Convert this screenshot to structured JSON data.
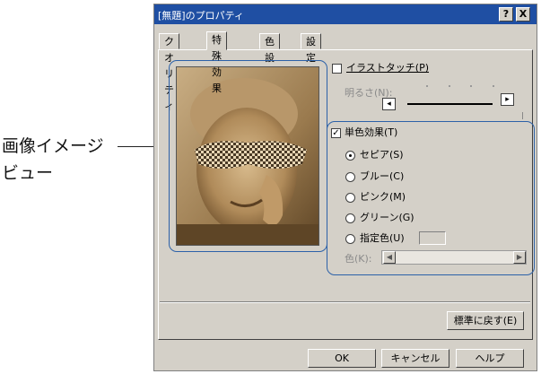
{
  "callout": {
    "line1": "画像イメージ",
    "line2": "ビュー"
  },
  "window": {
    "title": "[無題]のプロパティ",
    "help_btn": "?",
    "close_btn": "X"
  },
  "tabs": [
    {
      "label": "クオリティ",
      "active": false
    },
    {
      "label": "特殊効果",
      "active": true
    },
    {
      "label": "色設定",
      "active": false
    },
    {
      "label": "設定登録",
      "active": false
    }
  ],
  "illustration_touch": {
    "label": "イラストタッチ(P)",
    "checked": false
  },
  "brightness": {
    "label": "明るさ(N):"
  },
  "monochrome": {
    "label": "単色効果(T)",
    "checked": true
  },
  "radios": [
    {
      "label": "セピア(S)",
      "selected": true
    },
    {
      "label": "ブルー(C)",
      "selected": false
    },
    {
      "label": "ピンク(M)",
      "selected": false
    },
    {
      "label": "グリーン(G)",
      "selected": false
    },
    {
      "label": "指定色(U)",
      "selected": false
    }
  ],
  "color_label": "色(K):",
  "restore_button": "標準に戻す(E)",
  "buttons": {
    "ok": "OK",
    "cancel": "キャンセル",
    "help": "ヘルプ"
  },
  "colors": {
    "title_bar": "#1f4fa3",
    "outline": "#2c61a8",
    "face": "#d4d0c8",
    "sepia": "#9a7a4e"
  }
}
